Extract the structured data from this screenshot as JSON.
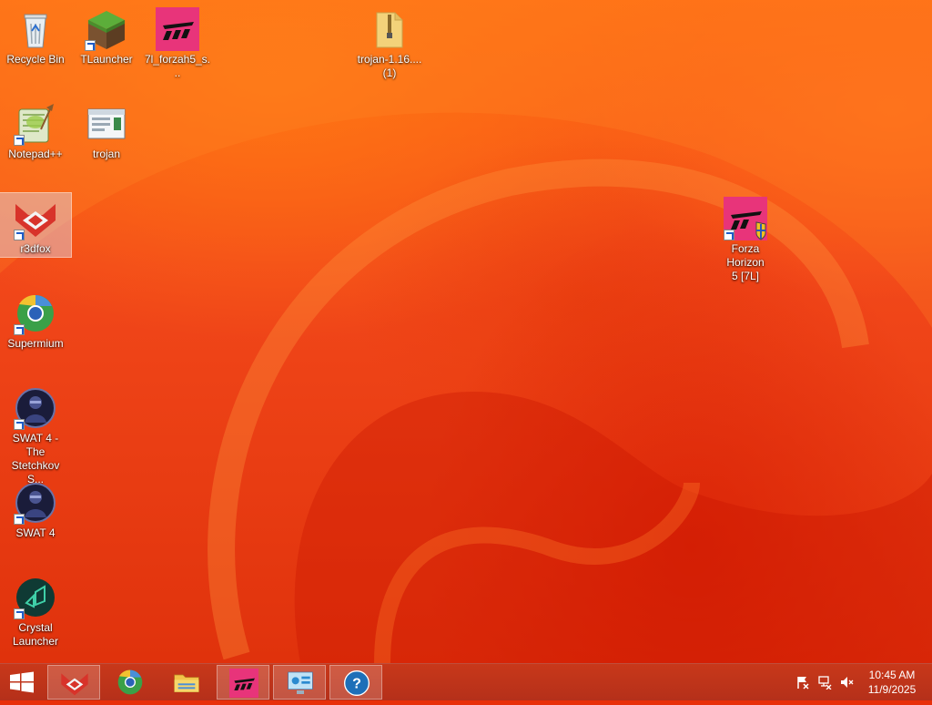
{
  "desktop": {
    "icons": {
      "recycle_bin": "Recycle Bin",
      "tlauncher": "TLauncher",
      "forzah5_s": "7l_forzah5_s...",
      "trojan_zip_line1": "trojan-1.16....",
      "trojan_zip_line2": "(1)",
      "notepadpp": "Notepad++",
      "trojan": "trojan",
      "r3dfox": "r3dfox",
      "supermium": "Supermium",
      "swat4_stetchkov_line1": "SWAT 4 - The",
      "swat4_stetchkov_line2": "Stetchkov S...",
      "swat4": "SWAT 4",
      "crystal_launcher_line1": "Crystal",
      "crystal_launcher_line2": "Launcher",
      "forza_line1": "Forza Horizon",
      "forza_line2": "5 [7L]"
    }
  },
  "taskbar": {
    "pinned": [
      "r3dfox-icon",
      "supermium-icon",
      "file-explorer-icon",
      "forza-icon",
      "control-panel-icon",
      "help-icon"
    ],
    "clock_time": "10:45 AM",
    "clock_date": "11/9/2025"
  },
  "colors": {
    "wallpaper": "#e8300a",
    "taskbar": "#b5301a",
    "forza_pink": "#e8347a"
  }
}
